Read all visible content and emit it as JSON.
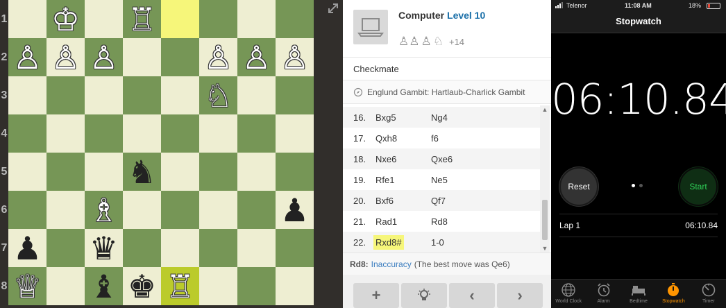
{
  "board": {
    "ranks": [
      "1",
      "2",
      "3",
      "4",
      "5",
      "6",
      "7",
      "8"
    ],
    "highlight_squares": [
      "r1c4",
      "r8c4"
    ],
    "pieces": [
      {
        "row": 1,
        "col": 1,
        "glyph": "♔",
        "color": "white",
        "name": "white-king"
      },
      {
        "row": 1,
        "col": 3,
        "glyph": "♖",
        "color": "white",
        "name": "white-rook"
      },
      {
        "row": 2,
        "col": 0,
        "glyph": "♙",
        "color": "white",
        "name": "white-pawn"
      },
      {
        "row": 2,
        "col": 1,
        "glyph": "♙",
        "color": "white",
        "name": "white-pawn"
      },
      {
        "row": 2,
        "col": 2,
        "glyph": "♙",
        "color": "white",
        "name": "white-pawn"
      },
      {
        "row": 2,
        "col": 5,
        "glyph": "♙",
        "color": "white",
        "name": "white-pawn"
      },
      {
        "row": 2,
        "col": 6,
        "glyph": "♙",
        "color": "white",
        "name": "white-pawn"
      },
      {
        "row": 2,
        "col": 7,
        "glyph": "♙",
        "color": "white",
        "name": "white-pawn"
      },
      {
        "row": 3,
        "col": 5,
        "glyph": "♘",
        "color": "white",
        "name": "white-knight"
      },
      {
        "row": 5,
        "col": 3,
        "glyph": "♞",
        "color": "black",
        "name": "black-knight"
      },
      {
        "row": 6,
        "col": 2,
        "glyph": "♗",
        "color": "white",
        "name": "white-bishop"
      },
      {
        "row": 6,
        "col": 7,
        "glyph": "♟",
        "color": "black",
        "name": "black-pawn"
      },
      {
        "row": 7,
        "col": 0,
        "glyph": "♟",
        "color": "black",
        "name": "black-pawn"
      },
      {
        "row": 7,
        "col": 2,
        "glyph": "♛",
        "color": "black",
        "name": "black-queen"
      },
      {
        "row": 8,
        "col": 0,
        "glyph": "♕",
        "color": "white",
        "name": "white-queen"
      },
      {
        "row": 8,
        "col": 2,
        "glyph": "♝",
        "color": "black",
        "name": "black-bishop"
      },
      {
        "row": 8,
        "col": 3,
        "glyph": "♚",
        "color": "black",
        "name": "black-king"
      },
      {
        "row": 8,
        "col": 4,
        "glyph": "♖",
        "color": "white",
        "name": "white-rook"
      }
    ],
    "colors": {
      "light": "#eeeed2",
      "dark": "#769656",
      "highlight_light": "#f6f67a",
      "highlight_dark": "#bbcb2b"
    }
  },
  "player": {
    "name": "Computer",
    "level": "Level 10",
    "captured": [
      "♙♙",
      "♙",
      "♘"
    ],
    "material": "+14"
  },
  "result": "Checkmate",
  "opening": "Englund Gambit: Hartlaub-Charlick Gambit",
  "moves": [
    {
      "num": "16.",
      "white": "Bxg5",
      "black": "Ng4"
    },
    {
      "num": "17.",
      "white": "Qxh8",
      "black": "f6"
    },
    {
      "num": "18.",
      "white": "Nxe6",
      "black": "Qxe6"
    },
    {
      "num": "19.",
      "white": "Rfe1",
      "black": "Ne5"
    },
    {
      "num": "20.",
      "white": "Bxf6",
      "black": "Qf7"
    },
    {
      "num": "21.",
      "white": "Rad1",
      "black": "Rd8"
    },
    {
      "num": "22.",
      "white": "Rxd8#",
      "black": "1-0"
    }
  ],
  "analysis": {
    "move": "Rd8:",
    "classification": "Inaccuracy",
    "detail": "(The best move was Qe6)"
  },
  "controls": {
    "add": "+",
    "hint": "hint",
    "back": "‹",
    "forward": "›"
  },
  "phone": {
    "carrier": "Telenor",
    "time": "11:08 AM",
    "battery": "18%",
    "battery_level": 0.18,
    "title": "Stopwatch",
    "elapsed": "06:10.84",
    "reset_label": "Reset",
    "start_label": "Start",
    "lap_label": "Lap 1",
    "lap_time": "06:10.84",
    "tabs": [
      {
        "label": "World Clock",
        "icon": "globe-icon"
      },
      {
        "label": "Alarm",
        "icon": "alarm-icon"
      },
      {
        "label": "Bedtime",
        "icon": "bed-icon"
      },
      {
        "label": "Stopwatch",
        "icon": "stopwatch-icon",
        "active": true
      },
      {
        "label": "Timer",
        "icon": "timer-icon"
      }
    ],
    "colors": {
      "accent": "#ff9500",
      "start_green": "#2fd158"
    }
  }
}
